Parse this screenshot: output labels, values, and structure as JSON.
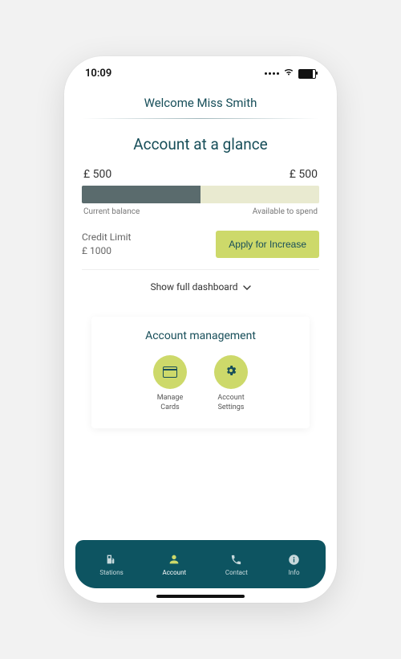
{
  "status": {
    "time": "10:09"
  },
  "header": {
    "welcome": "Welcome Miss Smith"
  },
  "glance": {
    "title": "Account at a glance",
    "left_amount": "£ 500",
    "right_amount": "£ 500",
    "left_label": "Current balance",
    "right_label": "Available to spend",
    "limit_label": "Credit Limit",
    "limit_value": "£ 1000",
    "apply_label": "Apply for Increase",
    "show_full": "Show full dashboard"
  },
  "management": {
    "title": "Account management",
    "items": [
      {
        "label": "Manage\nCards"
      },
      {
        "label": "Account\nSettings"
      }
    ]
  },
  "nav": {
    "items": [
      {
        "label": "Stations"
      },
      {
        "label": "Account"
      },
      {
        "label": "Contact"
      },
      {
        "label": "Info"
      }
    ]
  },
  "chart_data": {
    "type": "bar",
    "title": "Account at a glance",
    "categories": [
      "Current balance",
      "Available to spend"
    ],
    "values": [
      500,
      500
    ],
    "total": 1000,
    "xlabel": "",
    "ylabel": "£",
    "ylim": [
      0,
      1000
    ]
  }
}
